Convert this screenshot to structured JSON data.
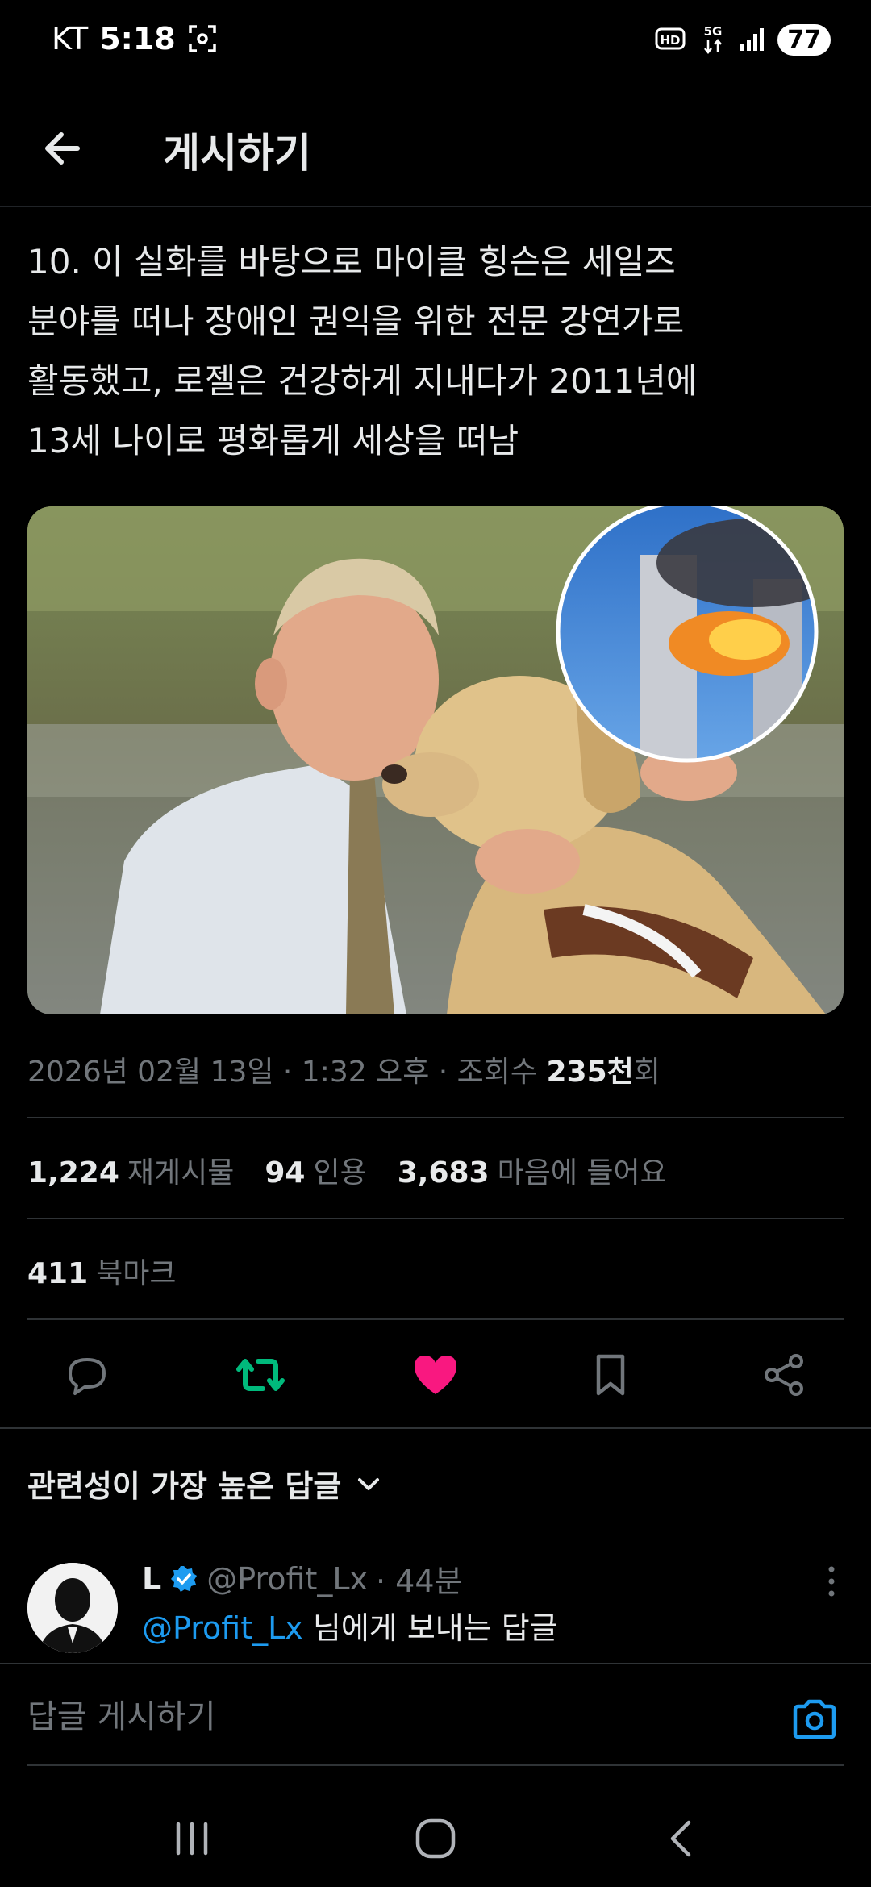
{
  "status_bar": {
    "carrier": "KT",
    "time": "5:18",
    "network": "5G",
    "hd_badge": "HD",
    "battery": "77"
  },
  "header": {
    "title": "게시하기"
  },
  "tweet": {
    "text": "10. 이 실화를 바탕으로 마이클 힝슨은 세일즈\n분야를 떠나 장애인 권익을 위한 전문 강연가로\n활동했고, 로젤은 건강하게 지내다가 2011년에\n13세 나이로 평화롭게 세상을 떠남",
    "meta_prefix": "2026년 02월 13일 · 1:32 오후 · 조회수 ",
    "views_number": "235천",
    "views_suffix": "회"
  },
  "stats": {
    "reposts_count": "1,224",
    "reposts_label": "재게시물",
    "quotes_count": "94",
    "quotes_label": "인용",
    "likes_count": "3,683",
    "likes_label": "마음에 들어요",
    "bookmarks_count": "411",
    "bookmarks_label": "북마크"
  },
  "actions": {
    "reply_icon": "comment-icon",
    "repost_icon": "repost-icon",
    "like_icon": "heart-icon",
    "bookmark_icon": "bookmark-icon",
    "share_icon": "share-icon"
  },
  "replies": {
    "sort_label": "관련성이 가장 높은 답글",
    "items": [
      {
        "name": "L",
        "handle": "@Profit_Lx",
        "time": "· 44분",
        "mention": "@Profit_Lx",
        "body_suffix": " 님에게 보내는 답글"
      }
    ]
  },
  "compose": {
    "placeholder": "답글 게시하기"
  },
  "colors": {
    "background": "#000000",
    "text_primary": "#e7e9ea",
    "text_secondary": "#71767b",
    "accent_blue": "#1d9bf0",
    "repost_green": "#00ba7c",
    "like_pink": "#f91880",
    "divider": "#2f3336"
  }
}
